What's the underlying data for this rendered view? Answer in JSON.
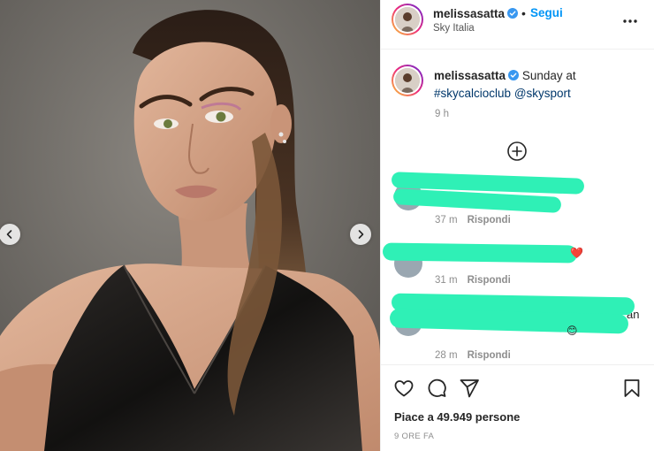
{
  "post": {
    "username": "melissasatta",
    "verified": true,
    "separator": "•",
    "follow_label": "Segui",
    "location": "Sky Italia",
    "more_icon": "more-horizontal-icon"
  },
  "caption": {
    "username": "melissasatta",
    "text_lead": " Sunday at",
    "hashtag": "#skycalcioclub",
    "mention": "@skysport",
    "time": "9 h"
  },
  "load_more_icon": "plus-circle-icon",
  "comments": [
    {
      "visible_fragment": "...",
      "time": "37 m",
      "reply_label": "Rispondi",
      "redacted": true
    },
    {
      "visible_fragment": "",
      "emoji": "❤️",
      "time": "31 m",
      "reply_label": "Rispondi",
      "redacted": true
    },
    {
      "visible_fragment": "an",
      "emoji": "😊",
      "time": "28 m",
      "reply_label": "Rispondi",
      "redacted": true
    }
  ],
  "actions": {
    "like_icon": "heart-icon",
    "comment_icon": "comment-icon",
    "share_icon": "send-icon",
    "save_icon": "bookmark-icon",
    "likes_text": "Piace a 49.949 persone",
    "time_ago": "9 ORE FA"
  },
  "carousel": {
    "prev_icon": "chevron-left-icon",
    "next_icon": "chevron-right-icon"
  },
  "colors": {
    "follow_blue": "#0095f6",
    "hashtag_blue": "#00376b",
    "redaction_highlight": "#2ff0b6",
    "verified_blue": "#3897f0"
  }
}
